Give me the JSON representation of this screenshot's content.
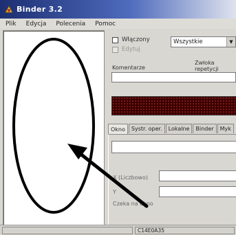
{
  "window": {
    "title": "Binder 3.2"
  },
  "menu": {
    "items": [
      "Plik",
      "Edycja",
      "Polecenia",
      "Pomoc"
    ]
  },
  "options": {
    "enabled_label": "Włączony",
    "edit_label": "Edytuj",
    "filter_value": "Wszystkie",
    "comment_label": "Komentarze",
    "comma_label": "Zwłoka repetycji",
    "comment_value": ""
  },
  "tabs": [
    "Okno",
    "Systr. oper.",
    "Lokalne",
    "Binder",
    "Myk"
  ],
  "fields": {
    "first_value": "",
    "x_label": "X (Liczbowo)",
    "y_label": "Y",
    "x_value": "",
    "y_value": "",
    "empty_window_label": "Czeka na okno"
  },
  "status": {
    "code": "C14E0A35"
  },
  "annotation": {
    "color": "#000000"
  }
}
